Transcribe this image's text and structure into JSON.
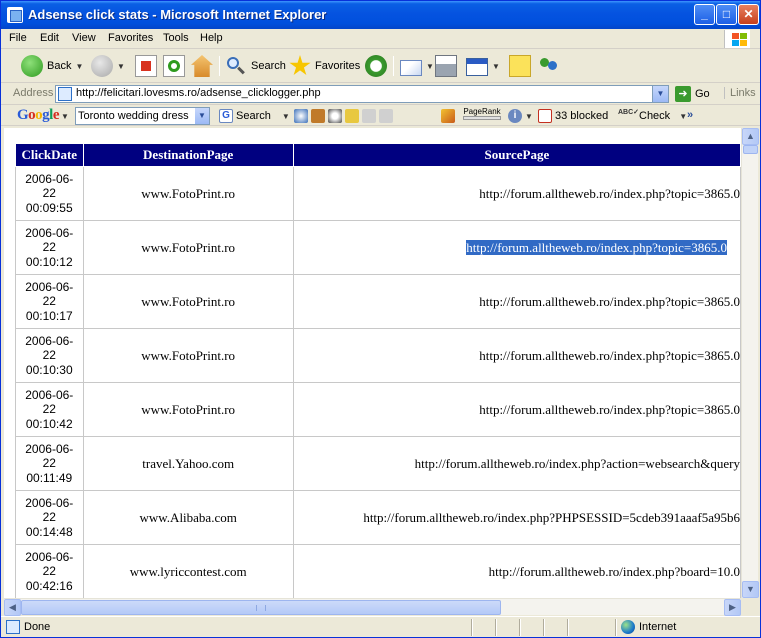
{
  "window": {
    "title": "Adsense click stats - Microsoft Internet Explorer"
  },
  "menu": [
    "File",
    "Edit",
    "View",
    "Favorites",
    "Tools",
    "Help"
  ],
  "toolbar": {
    "back": "Back",
    "search": "Search",
    "favorites": "Favorites"
  },
  "address": {
    "label": "Address",
    "url": "http://felicitari.lovesms.ro/adsense_clicklogger.php",
    "go": "Go",
    "links": "Links"
  },
  "google_bar": {
    "logo": "Google",
    "search_value": "Toronto wedding dress",
    "search_label": "Search",
    "pagerank": "PageRank",
    "blocked": "33 blocked",
    "check": "Check"
  },
  "table": {
    "headers": [
      "ClickDate",
      "DestinationPage",
      "SourcePage"
    ],
    "rows": [
      {
        "date": [
          "2006-06-",
          "22",
          "00:09:55"
        ],
        "dest": "www.FotoPrint.ro",
        "source": "http://forum.alltheweb.ro/index.php?topic=3865.0",
        "selected": false
      },
      {
        "date": [
          "2006-06-",
          "22",
          "00:10:12"
        ],
        "dest": "www.FotoPrint.ro",
        "source": "http://forum.alltheweb.ro/index.php?topic=3865.0",
        "selected": true
      },
      {
        "date": [
          "2006-06-",
          "22",
          "00:10:17"
        ],
        "dest": "www.FotoPrint.ro",
        "source": "http://forum.alltheweb.ro/index.php?topic=3865.0",
        "selected": false
      },
      {
        "date": [
          "2006-06-",
          "22",
          "00:10:30"
        ],
        "dest": "www.FotoPrint.ro",
        "source": "http://forum.alltheweb.ro/index.php?topic=3865.0",
        "selected": false
      },
      {
        "date": [
          "2006-06-",
          "22",
          "00:10:42"
        ],
        "dest": "www.FotoPrint.ro",
        "source": "http://forum.alltheweb.ro/index.php?topic=3865.0",
        "selected": false
      },
      {
        "date": [
          "2006-06-",
          "22",
          "00:11:49"
        ],
        "dest": "travel.Yahoo.com",
        "source": "http://forum.alltheweb.ro/index.php?action=websearch&query",
        "selected": false
      },
      {
        "date": [
          "2006-06-",
          "22",
          "00:14:48"
        ],
        "dest": "www.Alibaba.com",
        "source": "http://forum.alltheweb.ro/index.php?PHPSESSID=5cdeb391aaaf5a95b6",
        "selected": false
      },
      {
        "date": [
          "2006-06-",
          "22",
          "00:42:16"
        ],
        "dest": "www.lyriccontest.com",
        "source": "http://forum.alltheweb.ro/index.php?board=10.0",
        "selected": false
      }
    ]
  },
  "status": {
    "text": "Done",
    "zone": "Internet"
  },
  "colors": {
    "titlebar": "#0553E0",
    "table_header": "#000080",
    "selection": "#316AC5"
  }
}
